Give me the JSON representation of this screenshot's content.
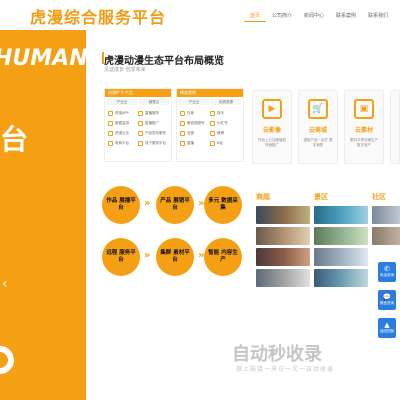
{
  "header": {
    "logo": "虎漫综合服务平台",
    "nav": [
      "首页",
      "公司简介",
      "新闻中心",
      "联系案例",
      "联系我们"
    ]
  },
  "hero": {
    "brand": "HUMAN",
    "big_text": "台",
    "arrow": "‹"
  },
  "section": {
    "title": "虎漫动漫生态平台布局概览",
    "subtitle": "见证成长 创享未来"
  },
  "panels": [
    {
      "head": "动漫IP X 产品",
      "tabs": [
        "产业云",
        "销售云"
      ],
      "rows": [
        "虎漫APP",
        "直播服务",
        "数据监测",
        "直播推广",
        "虎漫云仓",
        "产品发布服务",
        "电商平台",
        "线下服务平台"
      ]
    },
    {
      "head": "精准营销",
      "tabs": [
        "产业云",
        "优质资源"
      ],
      "rows": [
        "抖音",
        "快手",
        "微信视频号",
        "小红书",
        "百度",
        "微博",
        "直播",
        "B站"
      ]
    }
  ],
  "cards": [
    {
      "icon": "▶",
      "title": "云影像",
      "desc": "作品上云加速播放 快速推广"
    },
    {
      "icon": "🛒",
      "title": "云商城",
      "desc": "虚拟产品一站式 数字销售"
    },
    {
      "icon": "▣",
      "title": "云素材",
      "desc": "素材共享加速生产 数字资产"
    },
    {
      "icon": "",
      "title": "",
      "desc": ""
    }
  ],
  "flow": [
    "作品 展播平台",
    "产品 展销平台",
    "多元 数据采集",
    "远程 服务平台",
    "集群 素材平台",
    "智能 内容生产"
  ],
  "photos": {
    "labels": [
      "商超",
      "景区",
      "社区"
    ]
  },
  "float_buttons": [
    {
      "icon": "✆",
      "label": "电话咨询"
    },
    {
      "icon": "💬",
      "label": "微信咨询"
    },
    {
      "icon": "▲",
      "label": "返回顶部"
    }
  ],
  "watermark": {
    "main": "自动秒收录",
    "sub": "做上链接一来访一次一自动收录"
  },
  "colors": {
    "accent": "#f5a014",
    "blue": "#2a7de1"
  }
}
